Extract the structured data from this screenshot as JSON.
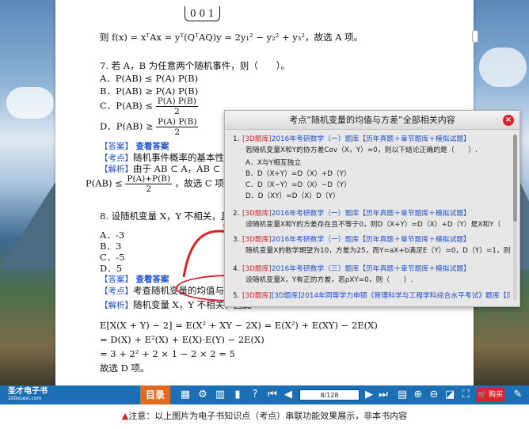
{
  "document": {
    "matrix_row": "0   0   1",
    "l1": "则 f(x) = xᵀAx = yᵀ(QᵀAQ)y = 2y₁² − y₂² + y₃²，故选 A 项。",
    "q7": "7. 若 A，B 为任意两个随机事件，则（　　）。",
    "q7a": "A．P(AB) ≤ P(A) P(B)",
    "q7b": "B．P(AB) ≥ P(A) P(B)",
    "q7c_pre": "C．P(AB) ≤",
    "q7d_pre": "D．P(AB) ≥",
    "frac_num": "P(A) P(B)",
    "frac_den": "2",
    "ans7_label": "【答案】",
    "ans7_link": "查看答案",
    "kp7_label": "【考点】",
    "kp7_text": "随机事件概率的基本性质。",
    "sol7_label": "【解析】",
    "sol7_text": "由于 AB ⊂ A，AB ⊂ B，故",
    "sol7_pre": "P(AB) ≤",
    "sol7_num": "P(A)+P(B)",
    "sol7_den": "2",
    "sol7_post": "，故选 C 项。",
    "q8": "8. 设随机变量 X，Y 不相关，且 EX",
    "q8a": "A．-3",
    "q8b": "B．3",
    "q8c": "C．-5",
    "q8d": "D．5",
    "ans8_label": "【答案】",
    "ans8_link": "查看答案",
    "kp8_label": "【考点】",
    "kp8_text": "考查随机变量的均值与方差。",
    "sol8_label": "【解析】",
    "sol8_text": "随机变量 X，Y 不相关，因此",
    "e1": "E[X(X + Y) − 2] = E(X² + XY − 2X) = E(X²) + E(XY) − 2E(X)",
    "e2": "= D(X) + E²(X) + E(X)·E(Y) − 2E(X)",
    "e3": "= 3 + 2² + 2 × 1 − 2 × 2 = 5",
    "e4": "故选 D 项。"
  },
  "popup": {
    "title": "考点“随机变量的均值与方差”全部相关内容",
    "items": [
      {
        "n": "1.",
        "tag": "[3D题库]",
        "title": "2016年考研数学（一）题库【历年真题＋章节题库＋模拟试题】",
        "lines": [
          "若随机变量X和Y的协方差Cov（X，Y）=0，则以下结论正确的是（　　）.",
          "A．X与Y相互独立",
          "B．D（X+Y）=D（X）+D（Y）",
          "C．D（X−Y）=D（X）−D（Y）",
          "D．D（XY）=D（X）D（Y）"
        ]
      },
      {
        "n": "2.",
        "tag": "[3D题库]",
        "title": "2016年考研数学（一）题库【历年真题＋章节题库＋模拟试题】",
        "lines": [
          "设随机变量X和Y的方差存在且不等于0，则D（X+Y）=D（X）+D（Y）是X和Y（　　）."
        ]
      },
      {
        "n": "3.",
        "tag": "[3D题库]",
        "title": "2016年考研数学（一）题库【历年真题＋章节题库＋模拟试题】",
        "lines": [
          "随机变量X的数学期望为10，方差为25，而Y=aX+b满足E（Y）=0，D（Y）=1，则常数..."
        ]
      },
      {
        "n": "4.",
        "tag": "[3D题库]",
        "title": "2016年考研数学（三）题库【历年真题＋章节题库＋模拟试题】",
        "lines": [
          "设随机变量X，Y有正的方差，若ρXY=0，则（　　）."
        ]
      },
      {
        "n": "5.",
        "tag": "[3D题库]",
        "title": "[3D题库]2014年同等学力申硕《管理科学与工程学科综合水平考试》题库【历年真题",
        "lines": []
      }
    ]
  },
  "toolbar": {
    "brand": "圣才电子书",
    "brand_sub": "100xuexi.com",
    "menu": "目录",
    "page_indicator": "8/128",
    "buy": "购买"
  },
  "note": "注意：以上图片为电子书知识点（考点）串联功能效果展示，非本书内容"
}
